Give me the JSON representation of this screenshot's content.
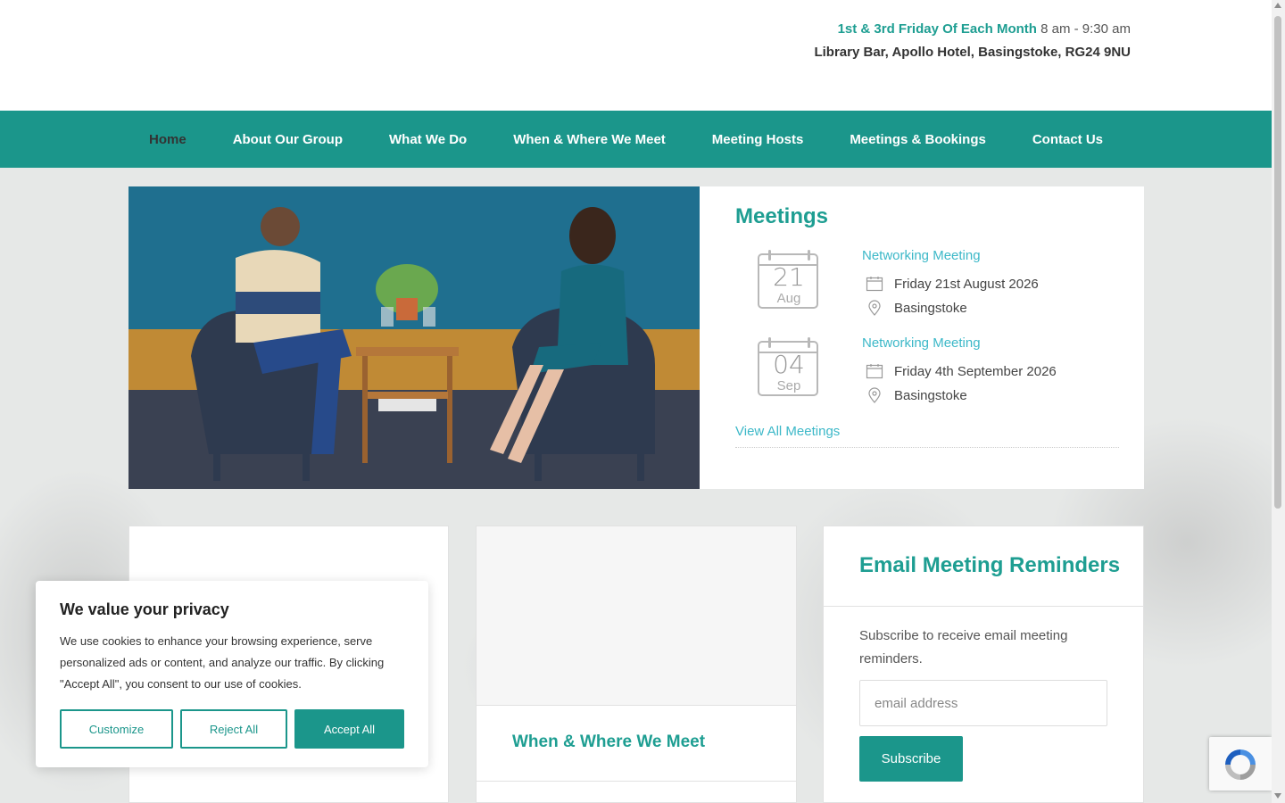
{
  "header": {
    "schedule_when": "1st & 3rd Friday Of Each Month",
    "schedule_time": "8 am - 9:30 am",
    "address": "Library Bar, Apollo Hotel, Basingstoke, RG24 9NU"
  },
  "nav": {
    "items": [
      "Home",
      "About Our Group",
      "What We Do",
      "When & Where We Meet",
      "Meeting Hosts",
      "Meetings & Bookings",
      "Contact Us"
    ],
    "active": "Home"
  },
  "meetings": {
    "title": "Meetings",
    "events": [
      {
        "day": "21",
        "month": "Aug",
        "name": "Networking Meeting",
        "date": "Friday 21st August 2026",
        "location": "Basingstoke"
      },
      {
        "day": "04",
        "month": "Sep",
        "name": "Networking Meeting",
        "date": "Friday 4th September 2026",
        "location": "Basingstoke"
      }
    ],
    "view_all": "View All Meetings"
  },
  "cards": {
    "when_where_title": "When & Where We Meet"
  },
  "reminders": {
    "title": "Email Meeting Reminders",
    "description": "Subscribe to receive email meeting reminders.",
    "email_placeholder": "email address",
    "subscribe_label": "Subscribe"
  },
  "cookie": {
    "title": "We value your privacy",
    "text": "We use cookies to enhance your browsing experience, serve personalized ads or content, and analyze our traffic. By clicking \"Accept All\", you consent to our use of cookies.",
    "customize": "Customize",
    "reject": "Reject All",
    "accept": "Accept All"
  },
  "colors": {
    "brand": "#1b968b",
    "link": "#3cb8c8",
    "heading": "#1e9e92"
  },
  "icons": {
    "calendar": "calendar-icon",
    "location": "map-pin-icon",
    "recaptcha": "recaptcha-icon"
  }
}
